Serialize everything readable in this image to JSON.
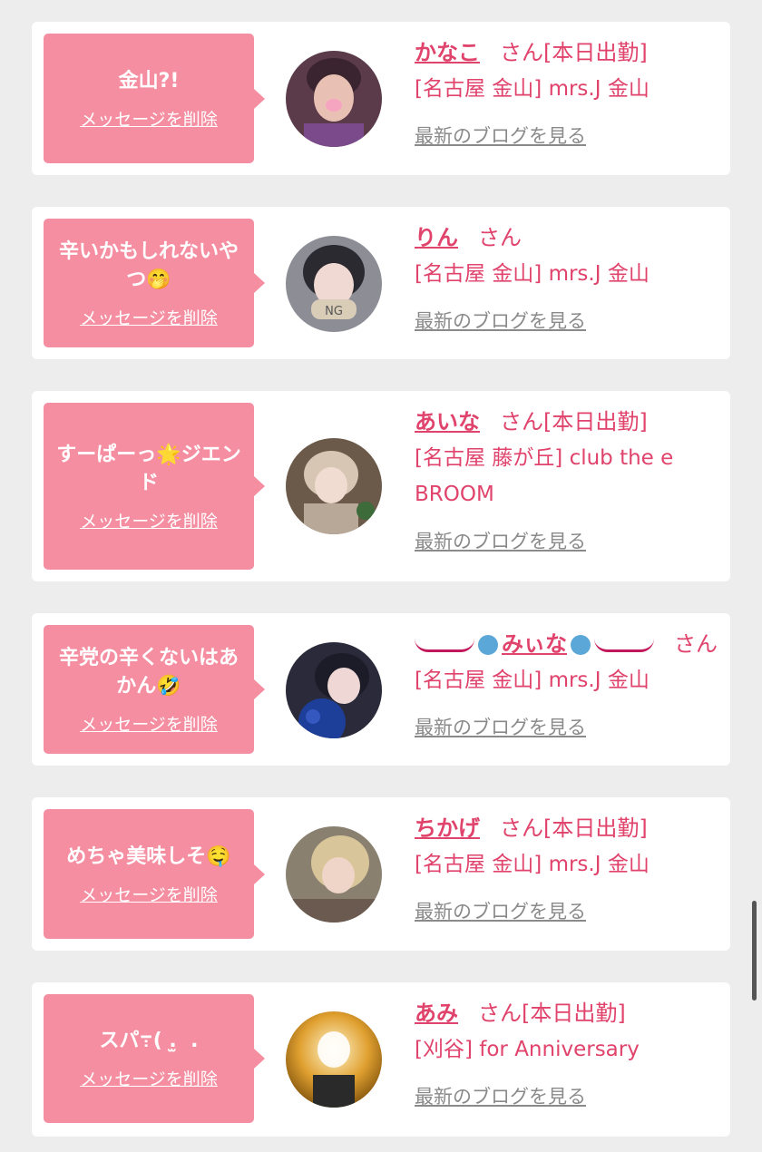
{
  "messages": [
    {
      "bubble_text": "金山?!",
      "delete_label": "メッセージを削除",
      "name": "かなこ",
      "honorific": "さん",
      "status": "[本日出勤]",
      "shop": "[名古屋 金山] mrs.J 金山",
      "blog_label": "最新のブログを見る"
    },
    {
      "bubble_text": "辛いかもしれないやつ🤭",
      "delete_label": "メッセージを削除",
      "name": "りん",
      "honorific": "さん",
      "status": "",
      "shop": "[名古屋 金山] mrs.J 金山",
      "blog_label": "最新のブログを見る"
    },
    {
      "bubble_text": "すーぱーっ🌟ジエンド",
      "delete_label": "メッセージを削除",
      "name": "あいな",
      "honorific": "さん",
      "status": "[本日出勤]",
      "shop": "[名古屋 藤が丘] club the e BROOM",
      "blog_label": "最新のブログを見る"
    },
    {
      "bubble_text": "辛党の辛くないはあかん🤣",
      "delete_label": "メッセージを削除",
      "name": "みぃな",
      "honorific": "さん",
      "status": "",
      "shop": "[名古屋 金山] mrs.J 金山",
      "blog_label": "最新のブログを見る"
    },
    {
      "bubble_text": "めちゃ美味しそ🤤",
      "delete_label": "メッセージを削除",
      "name": "ちかげ",
      "honorific": "さん",
      "status": "[本日出勤]",
      "shop": "[名古屋 金山] mrs.J 金山",
      "blog_label": "最新のブログを見る"
    },
    {
      "bubble_text": "スパ߹( . ̫ .",
      "delete_label": "メッセージを削除",
      "name": "あみ",
      "honorific": "さん",
      "status": "[本日出勤]",
      "shop": "[刈谷] for Anniversary",
      "blog_label": "最新のブログを見る"
    }
  ],
  "colors": {
    "bubble": "#f58ea1",
    "accent": "#e0436b",
    "blog_link": "#8a8a8a",
    "page_bg": "#ededed"
  }
}
